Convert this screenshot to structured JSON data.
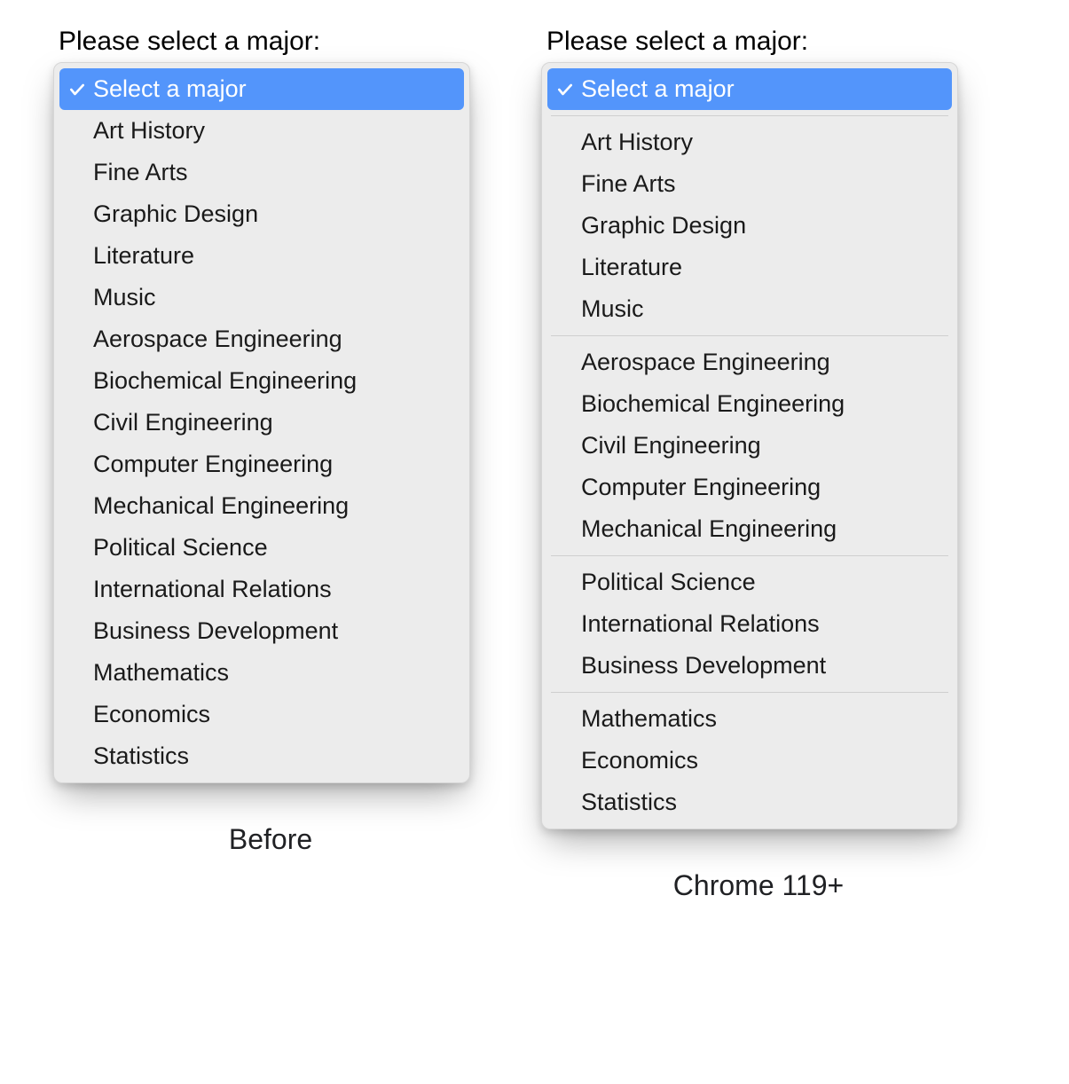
{
  "accent": "#5395fb",
  "prompt": "Please select a major:",
  "selected_label": "Select a major",
  "left": {
    "caption": "Before",
    "items": [
      "Art History",
      "Fine Arts",
      "Graphic Design",
      "Literature",
      "Music",
      "Aerospace Engineering",
      "Biochemical Engineering",
      "Civil Engineering",
      "Computer Engineering",
      "Mechanical Engineering",
      "Political Science",
      "International Relations",
      "Business Development",
      "Mathematics",
      "Economics",
      "Statistics"
    ]
  },
  "right": {
    "caption": "Chrome 119+",
    "groups": [
      [
        "Art History",
        "Fine Arts",
        "Graphic Design",
        "Literature",
        "Music"
      ],
      [
        "Aerospace Engineering",
        "Biochemical Engineering",
        "Civil Engineering",
        "Computer Engineering",
        "Mechanical Engineering"
      ],
      [
        "Political Science",
        "International Relations",
        "Business Development"
      ],
      [
        "Mathematics",
        "Economics",
        "Statistics"
      ]
    ]
  }
}
